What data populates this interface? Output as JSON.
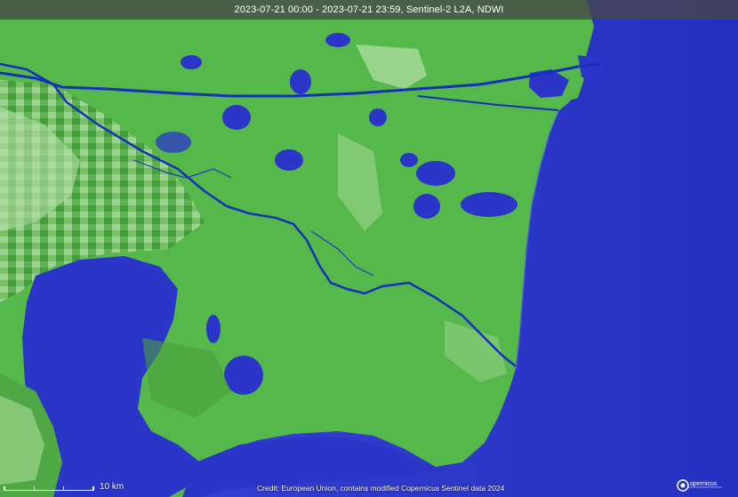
{
  "title": "2023-07-21 00:00 - 2023-07-21 23:59, Sentinel-2 L2A, NDWI",
  "scale_label": "10 km",
  "credit": "Credit: European Union, contains modified Copernicus Sentinel data 2024",
  "logo_text": "Copernicus",
  "colors": {
    "water": "#2b35c8",
    "land": "#55b84a",
    "land_light": "#9fd48f",
    "land_dark": "#2f8a2e",
    "channel": "#1730b8"
  }
}
